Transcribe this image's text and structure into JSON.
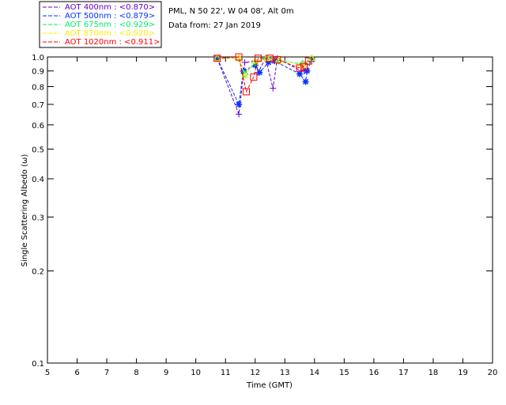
{
  "chart_data": {
    "type": "scatter",
    "header": [
      "PML, N 50 22', W 04 08', Alt 0m",
      "Data from: 27 Jan 2019"
    ],
    "xlabel": "Time (GMT)",
    "ylabel": "Single Scattering Albedo (ω)",
    "xlim": [
      5,
      20
    ],
    "ylim": [
      0.1,
      1.0
    ],
    "yscale": "log",
    "xticks": [
      "5",
      "6",
      "7",
      "8",
      "9",
      "10",
      "11",
      "12",
      "13",
      "14",
      "15",
      "16",
      "17",
      "18",
      "19",
      "20"
    ],
    "yticks": [
      "0.1",
      "0.2",
      "0.3",
      "0.4",
      "0.5",
      "0.6",
      "0.7",
      "0.8",
      "0.9",
      "1.0"
    ],
    "legend_placement": "top-left outside",
    "series": [
      {
        "name": "AOT  400nm : <0.870>",
        "color": "#6600cc",
        "marker": "plus",
        "points": [
          [
            10.72,
            0.99
          ],
          [
            11.45,
            0.65
          ],
          [
            11.65,
            0.96
          ],
          [
            12.0,
            0.97
          ],
          [
            12.1,
            0.89
          ],
          [
            12.35,
            0.99
          ],
          [
            12.6,
            0.79
          ],
          [
            12.75,
            0.99
          ],
          [
            13.55,
            0.9
          ],
          [
            13.65,
            0.9
          ],
          [
            13.85,
            0.97
          ]
        ]
      },
      {
        "name": "AOT  500nm : <0.879>",
        "color": "#0033ff",
        "marker": "star",
        "points": [
          [
            10.72,
            0.99
          ],
          [
            11.45,
            0.7
          ],
          [
            11.6,
            0.9
          ],
          [
            12.0,
            0.94
          ],
          [
            12.15,
            0.89
          ],
          [
            12.45,
            0.96
          ],
          [
            12.65,
            0.97
          ],
          [
            13.5,
            0.88
          ],
          [
            13.7,
            0.83
          ],
          [
            13.75,
            0.9
          ],
          [
            13.9,
            0.98
          ]
        ]
      },
      {
        "name": "AOT  675nm : <0.929>",
        "color": "#00ee66",
        "marker": "diamond",
        "points": [
          [
            10.72,
            0.99
          ],
          [
            11.45,
            0.99
          ],
          [
            11.65,
            0.88
          ],
          [
            12.0,
            0.96
          ],
          [
            12.4,
            0.99
          ],
          [
            12.8,
            0.97
          ],
          [
            13.6,
            0.95
          ],
          [
            13.9,
            0.99
          ]
        ]
      },
      {
        "name": "AOT  870nm : <0.920>",
        "color": "#ffee00",
        "marker": "triangle",
        "points": [
          [
            10.72,
            0.99
          ],
          [
            11.45,
            0.99
          ],
          [
            11.65,
            0.87
          ],
          [
            12.0,
            0.97
          ],
          [
            12.4,
            0.99
          ],
          [
            12.8,
            0.98
          ],
          [
            13.6,
            0.94
          ],
          [
            13.9,
            0.99
          ]
        ]
      },
      {
        "name": "AOT 1020nm : <0.911>",
        "color": "#ff0000",
        "marker": "square",
        "points": [
          [
            10.72,
            0.99
          ],
          [
            11.45,
            1.0
          ],
          [
            11.7,
            0.77
          ],
          [
            11.95,
            0.86
          ],
          [
            12.1,
            0.99
          ],
          [
            12.5,
            0.99
          ],
          [
            12.75,
            0.98
          ],
          [
            13.5,
            0.92
          ],
          [
            13.65,
            0.93
          ],
          [
            13.8,
            0.97
          ]
        ]
      }
    ]
  }
}
